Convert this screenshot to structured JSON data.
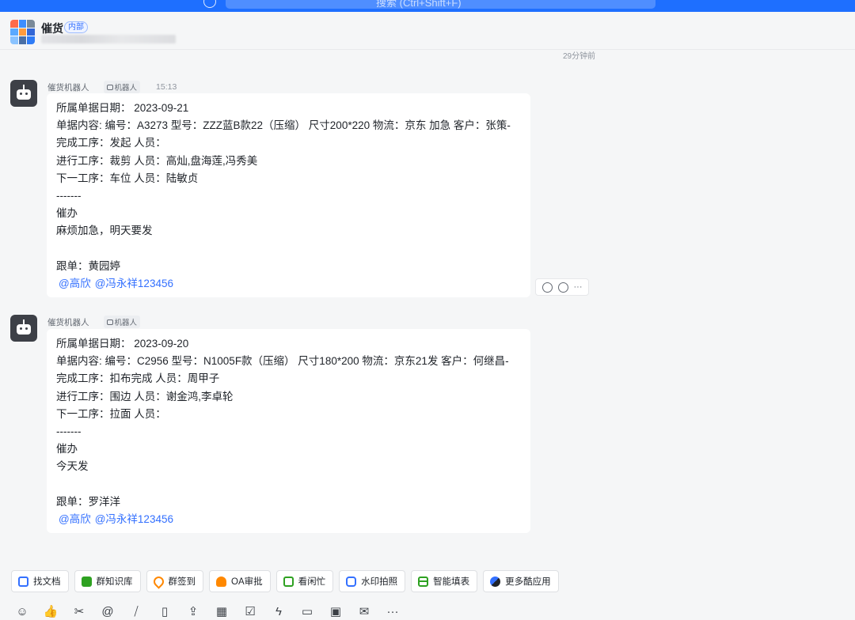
{
  "topbar": {
    "search_placeholder": "搜索 (Ctrl+Shift+F)"
  },
  "header": {
    "group_name": "催货",
    "internal_badge": "内部"
  },
  "time_divider": "29分钟前",
  "messages": [
    {
      "sender": "催货机器人",
      "bot_tag": "机器人",
      "time": "15:13",
      "lines": [
        "所属单据日期： 2023-09-21",
        "单据内容:  编号：A3273 型号：ZZZ蓝B款22（压缩） 尺寸200*220 物流：京东 加急 客户：张策-",
        "完成工序：发起 人员：",
        "进行工序：裁剪 人员：高灿,盘海莲,冯秀美",
        "下一工序：车位 人员：陆敏贞",
        "-------",
        "催办",
        "麻烦加急，明天要发",
        "",
        "跟单：黄园婷"
      ],
      "mentions": [
        "@高欣",
        "@冯永祥123456"
      ]
    },
    {
      "sender": "催货机器人",
      "bot_tag": "机器人",
      "time": "",
      "lines": [
        "所属单据日期： 2023-09-20",
        "单据内容:  编号：C2956 型号：N1005F款（压缩） 尺寸180*200 物流：京东21发 客户：何继昌-",
        "完成工序：扣布完成 人员：周甲子",
        "进行工序：围边 人员：谢金鸿,李卓轮",
        "下一工序：拉面 人员：",
        "-------",
        "催办",
        "今天发",
        "",
        "跟单：罗洋洋"
      ],
      "mentions": [
        "@高欣",
        "@冯永祥123456"
      ]
    }
  ],
  "apps": [
    {
      "label": "找文档",
      "icon": "doc-search-icon",
      "color": "#3370ff"
    },
    {
      "label": "群知识库",
      "icon": "knowledge-base-icon",
      "color": "#2ea121"
    },
    {
      "label": "群签到",
      "icon": "checkin-location-icon",
      "color": "#ff8800"
    },
    {
      "label": "OA审批",
      "icon": "approval-icon",
      "color": "#ff8800"
    },
    {
      "label": "看闲忙",
      "icon": "calendar-check-icon",
      "color": "#2ea121"
    },
    {
      "label": "水印拍照",
      "icon": "camera-icon",
      "color": "#3370ff"
    },
    {
      "label": "智能填表",
      "icon": "table-grid-icon",
      "color": "#2ea121"
    },
    {
      "label": "更多酷应用",
      "icon": "more-apps-icon",
      "color": "#3370ff"
    }
  ],
  "toolbar_icons": [
    {
      "name": "emoji-icon",
      "glyph": "☺"
    },
    {
      "name": "thumbs-up-icon",
      "glyph": "👍"
    },
    {
      "name": "scissors-icon",
      "glyph": "✂"
    },
    {
      "name": "at-mention-icon",
      "glyph": "@"
    },
    {
      "name": "slash-command-icon",
      "glyph": "⧸"
    },
    {
      "name": "doc-add-icon",
      "glyph": "▯"
    },
    {
      "name": "upload-file-icon",
      "glyph": "⇪"
    },
    {
      "name": "calendar-icon",
      "glyph": "▦"
    },
    {
      "name": "task-check-icon",
      "glyph": "☑"
    },
    {
      "name": "quick-action-icon",
      "glyph": "ϟ"
    },
    {
      "name": "video-call-icon",
      "glyph": "▭"
    },
    {
      "name": "live-icon",
      "glyph": "▣"
    },
    {
      "name": "mail-icon",
      "glyph": "✉"
    },
    {
      "name": "more-icon",
      "glyph": "···"
    }
  ]
}
